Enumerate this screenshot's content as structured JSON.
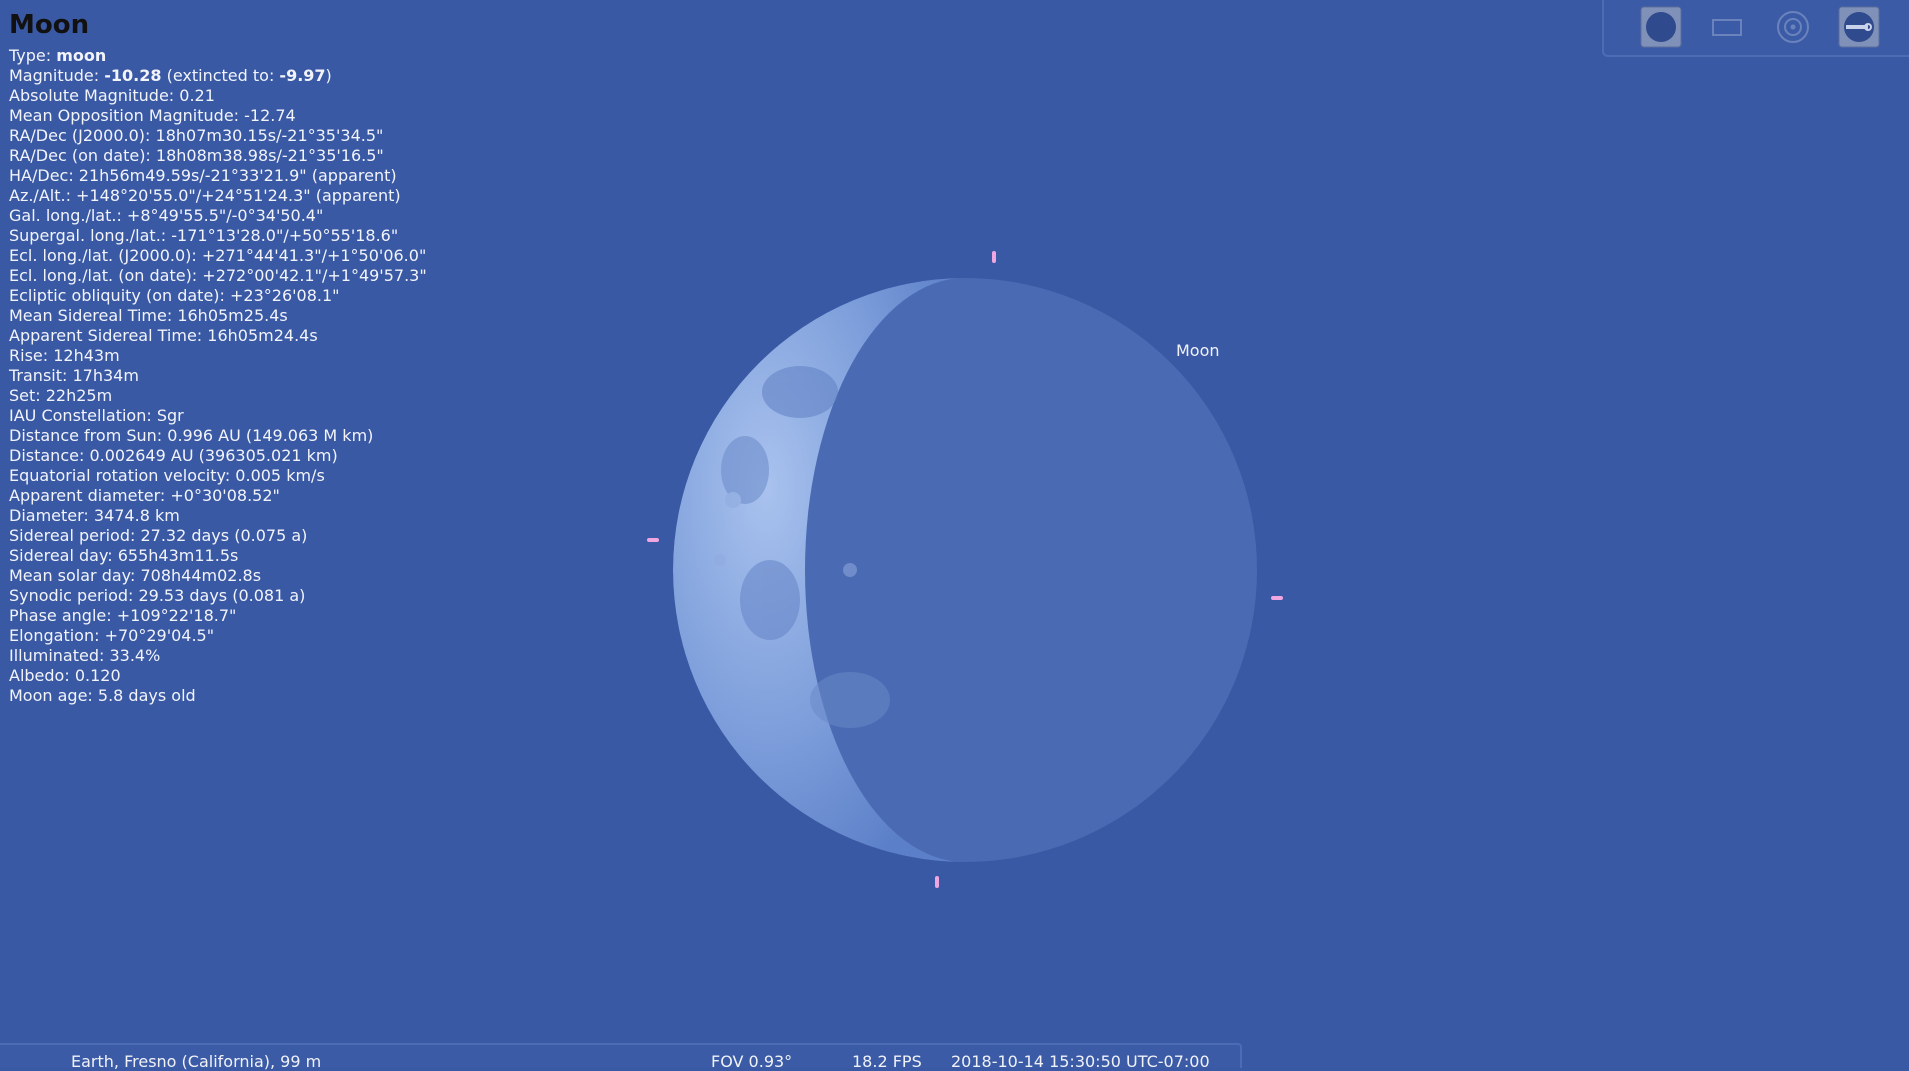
{
  "object": {
    "name": "Moon",
    "lines": [
      {
        "label": "Type: ",
        "bold": "moon",
        "rest": ""
      },
      {
        "label": "Magnitude: ",
        "bold": "-10.28",
        "rest": " (extincted to: ",
        "bold2": "-9.97",
        "rest2": ")"
      },
      {
        "label": "Absolute Magnitude: 0.21"
      },
      {
        "label": "Mean Opposition Magnitude: -12.74"
      },
      {
        "label": "RA/Dec (J2000.0): 18h07m30.15s/-21°35'34.5\""
      },
      {
        "label": "RA/Dec (on date): 18h08m38.98s/-21°35'16.5\""
      },
      {
        "label": "HA/Dec: 21h56m49.59s/-21°33'21.9\" (apparent)"
      },
      {
        "label": "Az./Alt.: +148°20'55.0\"/+24°51'24.3\" (apparent)"
      },
      {
        "label": "Gal. long./lat.: +8°49'55.5\"/-0°34'50.4\""
      },
      {
        "label": "Supergal. long./lat.: -171°13'28.0\"/+50°55'18.6\""
      },
      {
        "label": "Ecl. long./lat. (J2000.0): +271°44'41.3\"/+1°50'06.0\""
      },
      {
        "label": "Ecl. long./lat. (on date): +272°00'42.1\"/+1°49'57.3\""
      },
      {
        "label": "Ecliptic obliquity (on date): +23°26'08.1\""
      },
      {
        "label": "Mean Sidereal Time: 16h05m25.4s"
      },
      {
        "label": "Apparent Sidereal Time: 16h05m24.4s"
      },
      {
        "label": "Rise: 12h43m"
      },
      {
        "label": "Transit: 17h34m"
      },
      {
        "label": "Set: 22h25m"
      },
      {
        "label": "IAU Constellation: Sgr"
      },
      {
        "label": "Distance from Sun: 0.996 AU (149.063 M km)"
      },
      {
        "label": "Distance: 0.002649 AU (396305.021 km)"
      },
      {
        "label": "Equatorial rotation velocity: 0.005 km/s"
      },
      {
        "label": "Apparent diameter: +0°30'08.52\""
      },
      {
        "label": "Diameter: 3474.8 km"
      },
      {
        "label": "Sidereal period: 27.32 days (0.075 a)"
      },
      {
        "label": "Sidereal day: 655h43m11.5s"
      },
      {
        "label": "Mean solar day: 708h44m02.8s"
      },
      {
        "label": "Synodic period: 29.53 days (0.081 a)"
      },
      {
        "label": "Phase angle: +109°22'18.7\""
      },
      {
        "label": "Elongation: +70°29'04.5\""
      },
      {
        "label": "Illuminated: 33.4%"
      },
      {
        "label": "Albedo: 0.120"
      },
      {
        "label": "Moon age: 5.8 days old"
      }
    ]
  },
  "sky_label": "Moon",
  "toolbar": {
    "buttons": [
      {
        "name": "planet-display-button",
        "icon": "filled-circle-icon"
      },
      {
        "name": "screen-frame-button",
        "icon": "rectangle-icon"
      },
      {
        "name": "target-button",
        "icon": "target-circle-icon"
      },
      {
        "name": "telescope-control-button",
        "icon": "telescope-icon"
      }
    ]
  },
  "statusbar": {
    "location": "Earth, Fresno (California), 99 m",
    "fov": "FOV 0.93°",
    "fps": "18.2 FPS",
    "datetime": "2018-10-14 15:30:50 UTC-07:00"
  },
  "colors": {
    "sky": "#3a59a5",
    "title": "#111111",
    "marker": "#f0a6e0"
  }
}
